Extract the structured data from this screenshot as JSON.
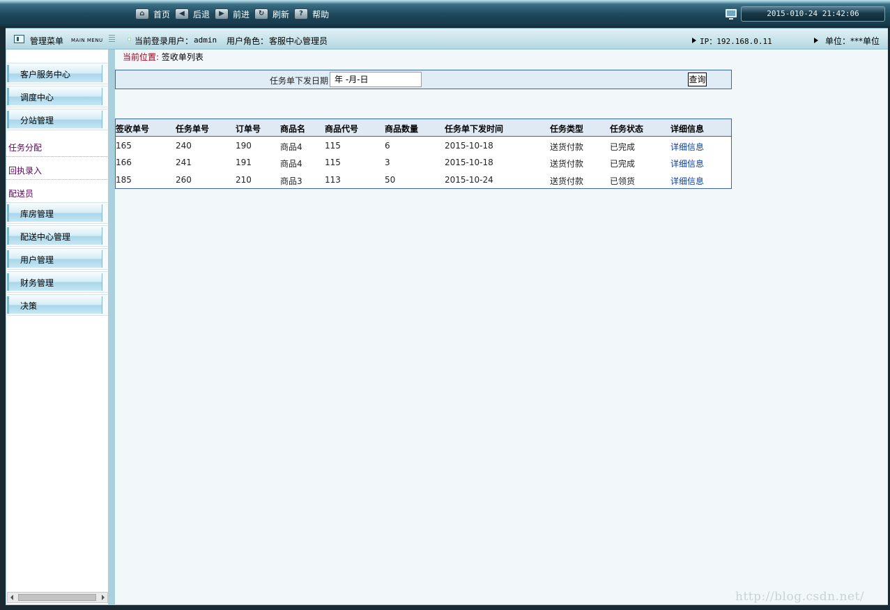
{
  "toolbar": {
    "items": [
      {
        "label": "首页",
        "icon": "home-icon"
      },
      {
        "label": "后退",
        "icon": "back-icon"
      },
      {
        "label": "前进",
        "icon": "forward-icon"
      },
      {
        "label": "刷新",
        "icon": "refresh-icon"
      },
      {
        "label": "帮助",
        "icon": "help-icon"
      }
    ],
    "datetime": "2015-010-24 21:42:06"
  },
  "infobar": {
    "menu_title": "管理菜单",
    "menu_title_en": "MAIN MENU",
    "login_label": "当前登录用户：",
    "login_user": "admin",
    "role_label": "用户角色：",
    "role_value": "客服中心管理员",
    "ip": "IP：192.168.0.11",
    "unit": "单位：***单位"
  },
  "sidebar": {
    "groups": [
      {
        "label": "客户服务中心"
      },
      {
        "label": "调度中心"
      },
      {
        "label": "分站管理"
      }
    ],
    "sub_items": [
      {
        "label": "任务分配"
      },
      {
        "label": "回执录入"
      },
      {
        "label": "配送员"
      }
    ],
    "groups_after": [
      {
        "label": "库房管理"
      },
      {
        "label": "配送中心管理"
      },
      {
        "label": "用户管理"
      },
      {
        "label": "财务管理"
      },
      {
        "label": "决策"
      }
    ]
  },
  "main": {
    "location_label": "当前位置:",
    "location_value": "签收单列表",
    "filter": {
      "label": "任务单下发日期",
      "date_placeholder": "年 -月-日",
      "query_label": "查询"
    },
    "table": {
      "headers": [
        "签收单号",
        "任务单号",
        "订单号",
        "商品名",
        "商品代号",
        "商品数量",
        "任务单下发时间",
        "任务类型",
        "任务状态",
        "详细信息"
      ],
      "rows": [
        [
          "165",
          "240",
          "190",
          "商品4",
          "115",
          "6",
          "2015-10-18",
          "送货付款",
          "已完成",
          "详细信息"
        ],
        [
          "166",
          "241",
          "191",
          "商品4",
          "115",
          "3",
          "2015-10-18",
          "送货付款",
          "已完成",
          "详细信息"
        ],
        [
          "185",
          "260",
          "210",
          "商品3",
          "113",
          "50",
          "2015-10-24",
          "送货付款",
          "已领货",
          "详细信息"
        ]
      ]
    }
  },
  "watermark": "http://blog.csdn.net/"
}
